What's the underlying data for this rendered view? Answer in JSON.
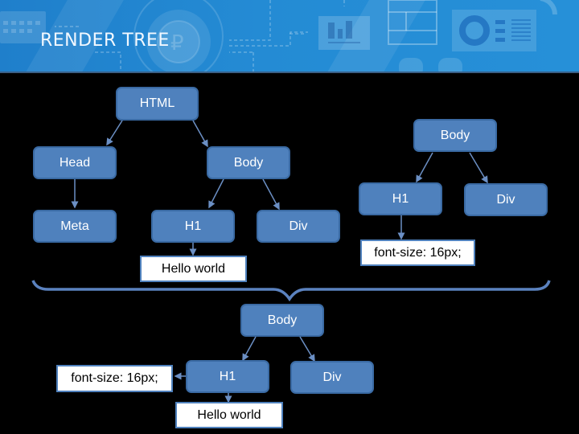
{
  "slide": {
    "title": "RENDER TREE"
  },
  "colors": {
    "banner": "#248bd4",
    "node_fill": "#4f81bd",
    "node_border": "#3a6aa3",
    "connector": "#6b8fc4",
    "background": "#000000"
  },
  "dom_tree": {
    "html": "HTML",
    "head": "Head",
    "body": "Body",
    "meta": "Meta",
    "h1": "H1",
    "div": "Div",
    "h1_text": "Hello world"
  },
  "cssom_tree": {
    "body": "Body",
    "h1": "H1",
    "div": "Div",
    "h1_style": "font-size: 16px;"
  },
  "render_tree": {
    "body": "Body",
    "h1": "H1",
    "div": "Div",
    "h1_style": "font-size: 16px;",
    "h1_text": "Hello world"
  },
  "icons": [
    "calendar-icon",
    "gear-ruble-icon",
    "chart-card-icon",
    "window-layout-icon",
    "dashboard-card-icon"
  ]
}
